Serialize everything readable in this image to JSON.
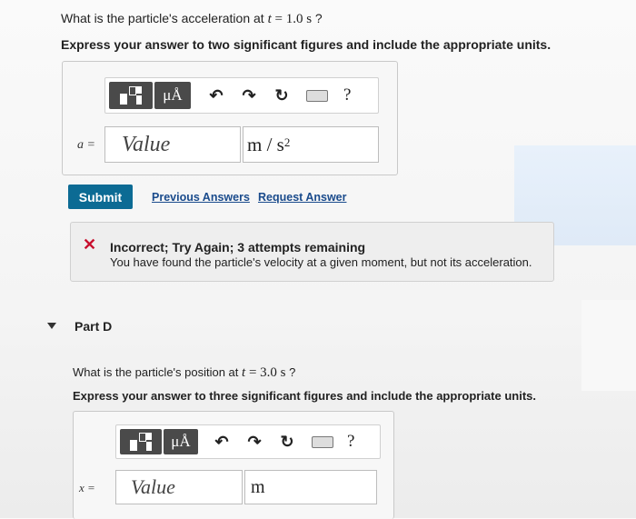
{
  "part_c": {
    "question_prefix": "What is the particle's acceleration at ",
    "question_var": "t",
    "question_eq": " = ",
    "question_value": "1.0 s",
    "question_suffix": " ?",
    "instruction": "Express your answer to two significant figures and include the appropriate units.",
    "toolbar": {
      "mu_label": "μÅ",
      "undo": "↶",
      "redo": "↷",
      "reset": "↻",
      "help": "?"
    },
    "var_label": "a =",
    "value_placeholder": "Value",
    "unit_value": "m / s",
    "unit_exp": "2"
  },
  "actions": {
    "submit_label": "Submit",
    "previous_answers": "Previous Answers",
    "request_answer": "Request Answer"
  },
  "feedback": {
    "icon": "✕",
    "title": "Incorrect; Try Again; 3 attempts remaining",
    "message": "You have found the particle's velocity at a given moment, but not its acceleration."
  },
  "part_d": {
    "label": "Part D",
    "question_prefix": "What is the particle's position at ",
    "question_var": "t",
    "question_eq": " = ",
    "question_value": "3.0 s",
    "question_suffix": " ?",
    "instruction": "Express your answer to three significant figures and include the appropriate units.",
    "toolbar": {
      "mu_label": "μÅ",
      "undo": "↶",
      "redo": "↷",
      "reset": "↻",
      "help": "?"
    },
    "var_label": "x =",
    "value_placeholder": "Value",
    "unit_value": "m"
  }
}
